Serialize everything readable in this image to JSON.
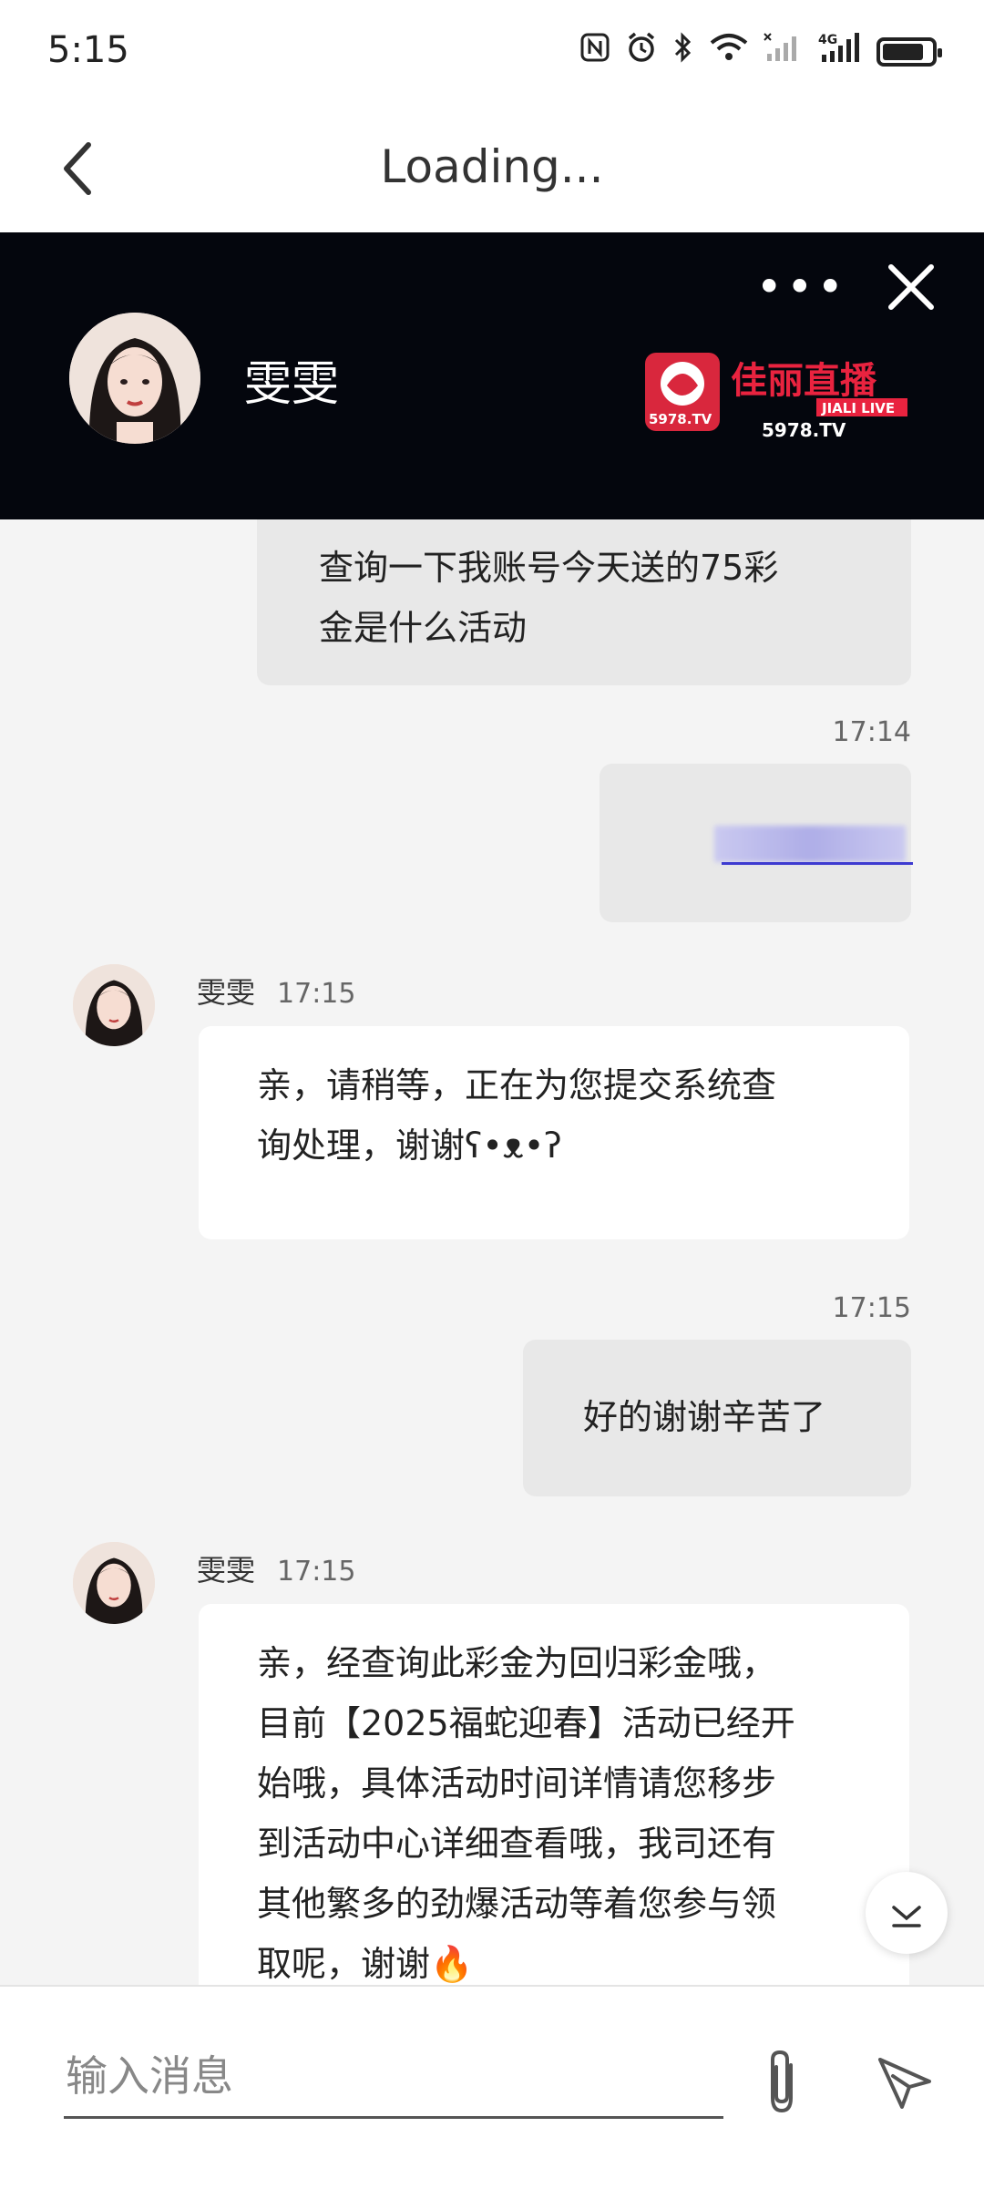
{
  "status_bar": {
    "time": "5:15",
    "icons": [
      "nfc-icon",
      "alarm-icon",
      "bluetooth-icon",
      "wifi-icon",
      "signal-icon",
      "4g-signal-icon",
      "battery-icon"
    ]
  },
  "nav": {
    "title": "Loading..."
  },
  "chat_header": {
    "agent_name": "雯雯",
    "more_label": "•••",
    "logo_text": "5978.TV",
    "logo_subtext": "JIALI LIVE",
    "logo_brand": "佳丽直播"
  },
  "messages": {
    "m1": {
      "line1": "查询一下我账号今天送的75彩",
      "line2": "金是什么活动"
    },
    "m2": {
      "time": "17:14"
    },
    "m3": {
      "sender": "雯雯",
      "time": "17:15",
      "line1": "亲，请稍等，正在为您提交系统查",
      "line2": "询处理，谢谢ʕ•ᴥ•ʔ"
    },
    "m4": {
      "time": "17:15",
      "text": "好的谢谢辛苦了"
    },
    "m5": {
      "sender": "雯雯",
      "time": "17:15",
      "line1": "亲，经查询此彩金为回归彩金哦，",
      "line2": "目前【2025福蛇迎春】活动已经开",
      "line3": "始哦，具体活动时间详情请您移步",
      "line4": "到活动中心详细查看哦，我司还有",
      "line5": "其他繁多的劲爆活动等着您参与领",
      "line6": "取呢，谢谢🔥"
    }
  },
  "input": {
    "placeholder": "输入消息"
  },
  "colors": {
    "header_bg": "#04060d",
    "page_bg": "#f4f4f4",
    "user_bubble": "#e8e8e8",
    "agent_bubble": "#ffffff"
  }
}
